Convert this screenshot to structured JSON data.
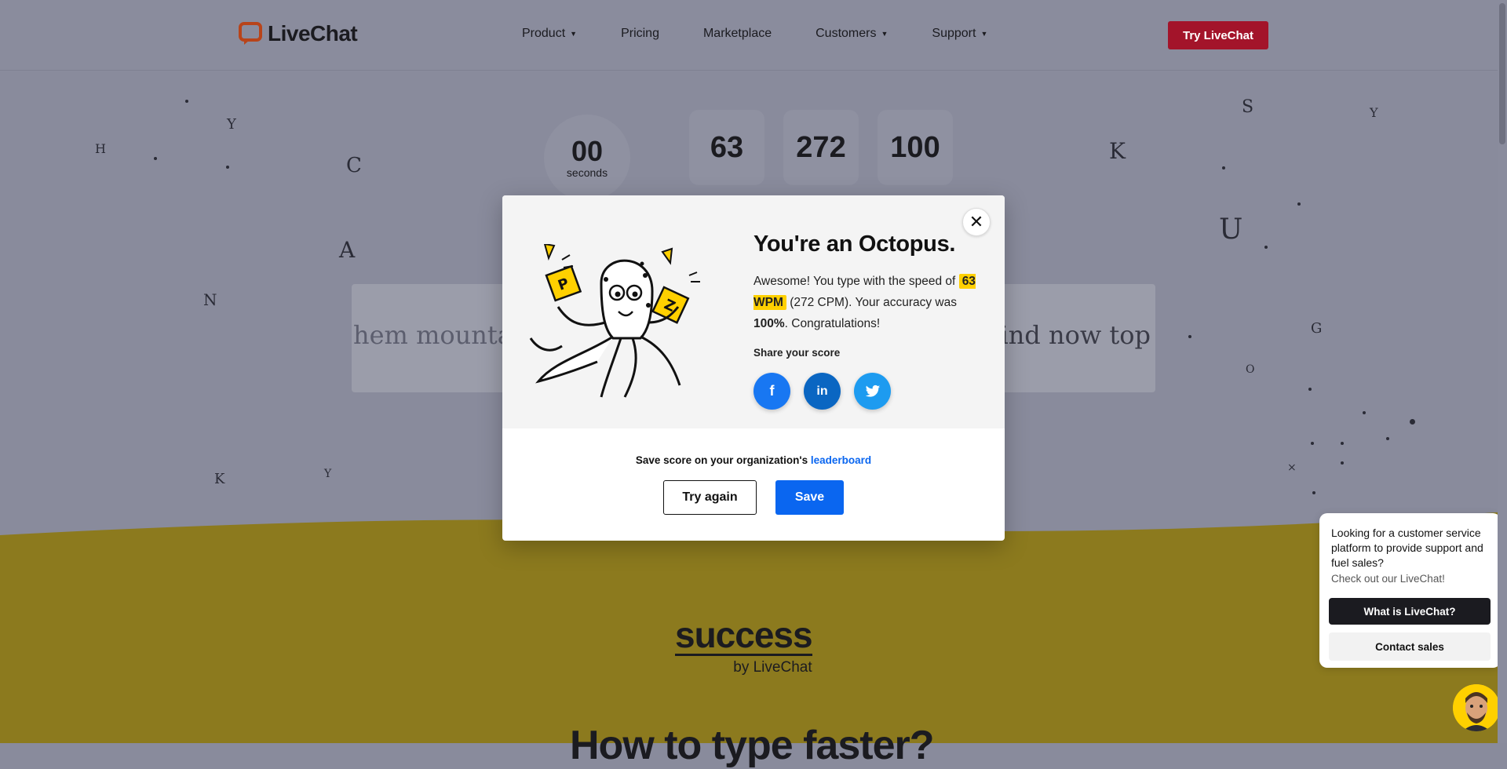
{
  "header": {
    "logo_text": "LiveChat",
    "nav": [
      "Product",
      "Pricing",
      "Marketplace",
      "Customers",
      "Support"
    ],
    "cta": "Try LiveChat"
  },
  "stats": {
    "timer_value": "00",
    "timer_unit": "seconds",
    "wpm": "63",
    "cpm": "272",
    "accuracy": "100"
  },
  "typing": {
    "left_text": "hem mounta",
    "right_text": "ind now top"
  },
  "modal": {
    "title": "You're an Octopus.",
    "text_1": "Awesome! You type with the speed of",
    "wpm_highlight": "63 WPM",
    "text_2": " (272 CPM). Your accuracy was ",
    "accuracy_strong": "100%",
    "text_3": ". Congratulations!",
    "share_label": "Share your score",
    "save_prefix": "Save score on your organization's ",
    "save_link": "leaderboard",
    "try_again": "Try again",
    "save": "Save"
  },
  "success": {
    "word": "success",
    "by": "by LiveChat"
  },
  "heading": "How to type faster?",
  "chat": {
    "message": "Looking for a customer service platform to provide support and fuel sales?",
    "sub": "Check out our LiveChat!",
    "primary": "What is LiveChat?",
    "secondary": "Contact sales"
  },
  "colors": {
    "brand_red": "#a3142a",
    "accent_yellow": "#ffd000",
    "link_blue": "#0a66f0",
    "facebook": "#1877f2",
    "linkedin": "#0a66c2",
    "twitter": "#1d9bf0"
  },
  "icons": [
    "livechat-logo-icon",
    "close-icon",
    "facebook-icon",
    "linkedin-icon",
    "twitter-icon",
    "octopus-illustration",
    "agent-avatar"
  ]
}
